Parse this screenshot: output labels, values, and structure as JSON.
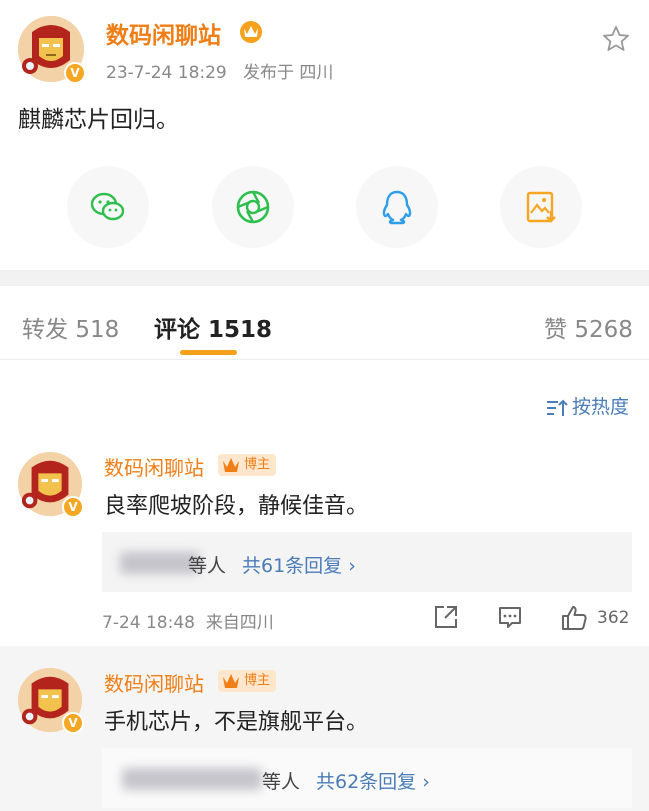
{
  "post": {
    "author": "数码闲聊站",
    "time": "23-7-24 18:29",
    "location": "发布于 四川",
    "text": "麒麟芯片回归。",
    "favorite_icon": "star-icon"
  },
  "share": [
    {
      "icon": "wechat-icon",
      "color": "#2fbf4f"
    },
    {
      "icon": "moments-icon",
      "color": "#2fbf4f"
    },
    {
      "icon": "qq-icon",
      "color": "#2f9ee8"
    },
    {
      "icon": "save-image-icon",
      "color": "#f5a623"
    }
  ],
  "tabs": {
    "repost_label": "转发",
    "repost_count": "518",
    "comment_label": "评论",
    "comment_count": "1518",
    "like_label": "赞",
    "like_count": "5268"
  },
  "sort": {
    "label": "按热度"
  },
  "comments": [
    {
      "author": "数码闲聊站",
      "badge": "博主",
      "text": "良率爬坡阶段，静候佳音。",
      "reply_suffix": "等人",
      "reply_link": "共61条回复 ›",
      "time": "7-24 18:48",
      "from": "来自四川",
      "likes": "362"
    },
    {
      "author": "数码闲聊站",
      "badge": "博主",
      "text": "手机芯片，不是旗舰平台。",
      "reply_suffix": "等人",
      "reply_link": "共62条回复 ›"
    }
  ],
  "colors": {
    "accent": "#f07e16",
    "link": "#4a7cb8",
    "tab_indicator": "#f7a11a"
  }
}
